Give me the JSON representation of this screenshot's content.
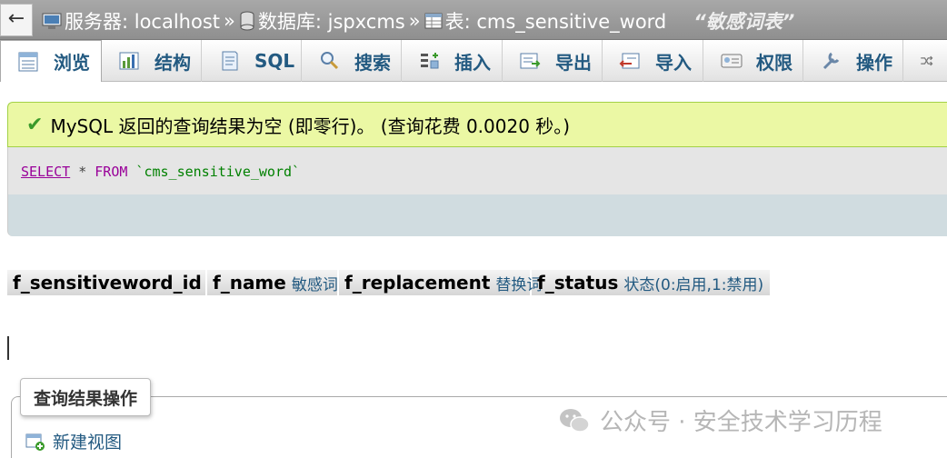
{
  "breadcrumb": {
    "server": "服务器: localhost",
    "database": "数据库: jspxcms",
    "table": "表: cms_sensitive_word",
    "comment": "“敏感词表”",
    "separator": "»"
  },
  "back_label": "←",
  "tabs": [
    {
      "label": "浏览",
      "icon": "browse-icon",
      "active": true
    },
    {
      "label": "结构",
      "icon": "structure-icon"
    },
    {
      "label": "SQL",
      "icon": "sql-icon"
    },
    {
      "label": "搜索",
      "icon": "search-icon"
    },
    {
      "label": "插入",
      "icon": "insert-icon"
    },
    {
      "label": "导出",
      "icon": "export-icon"
    },
    {
      "label": "导入",
      "icon": "import-icon"
    },
    {
      "label": "权限",
      "icon": "privileges-icon"
    },
    {
      "label": "操作",
      "icon": "operations-icon"
    }
  ],
  "message": "MySQL 返回的查询结果为空 (即零行)。 (查询花费 0.0020 秒。)",
  "sql": {
    "select": "SELECT",
    "star": " * ",
    "from": "FROM",
    "table": " `cms_sensitive_word`"
  },
  "columns": [
    {
      "name": "f_sensitiveword_id",
      "comment": ""
    },
    {
      "name": "f_name",
      "comment": "敏感词"
    },
    {
      "name": "f_replacement",
      "comment": "替换词"
    },
    {
      "name": "f_status",
      "comment": "状态(0:启用,1:禁用)"
    }
  ],
  "ops": {
    "legend": "查询结果操作",
    "create_view": "新建视图"
  },
  "watermark": "公众号 · 安全技术学习历程",
  "colors": {
    "link": "#235a81",
    "success_bg": "#ebf8a4",
    "sql_keyword": "#990099"
  }
}
